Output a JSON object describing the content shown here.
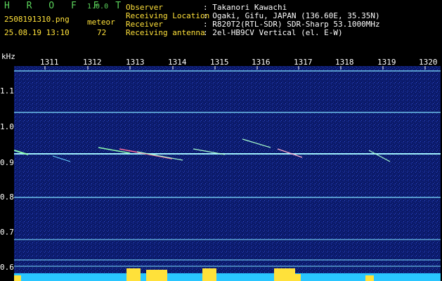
{
  "header": {
    "app_name": "H R O F F T",
    "version": "1.0.0",
    "filename": "2508191310.png",
    "datetime": "25.08.19 13:10",
    "meteor_label": "meteor",
    "meteor_count": "72",
    "fields": [
      {
        "label": "Observer",
        "value": ": Takanori Kawachi"
      },
      {
        "label": "Receiving Location",
        "value": ": Ogaki, Gifu, JAPAN (136.60E, 35.35N)"
      },
      {
        "label": "Receiver",
        "value": ": R820T2(RTL-SDR) SDR-Sharp 53.1000MHz"
      },
      {
        "label": "Receiving antenna",
        "value": ": 2el-HB9CV Vertical (el. E-W)"
      }
    ]
  },
  "axis": {
    "y_unit": "kHz",
    "x_ticks": [
      "1311",
      "1312",
      "1313",
      "1314",
      "1315",
      "1316",
      "1317",
      "1318",
      "1319",
      "1320"
    ],
    "y_ticks": [
      "1.1",
      "1.0",
      "0.9",
      "0.8",
      "0.7",
      "0.6"
    ]
  },
  "colors": {
    "background": "#000000",
    "plot_bg": "#0b1a6a",
    "accent_green": "#5bd35b",
    "label_yellow": "#ffe13a",
    "trace_cyan": "#7fe0ff",
    "bottom_bar_cyan": "#29c6ff",
    "bottom_bar_yellow": "#ffe13a"
  }
}
